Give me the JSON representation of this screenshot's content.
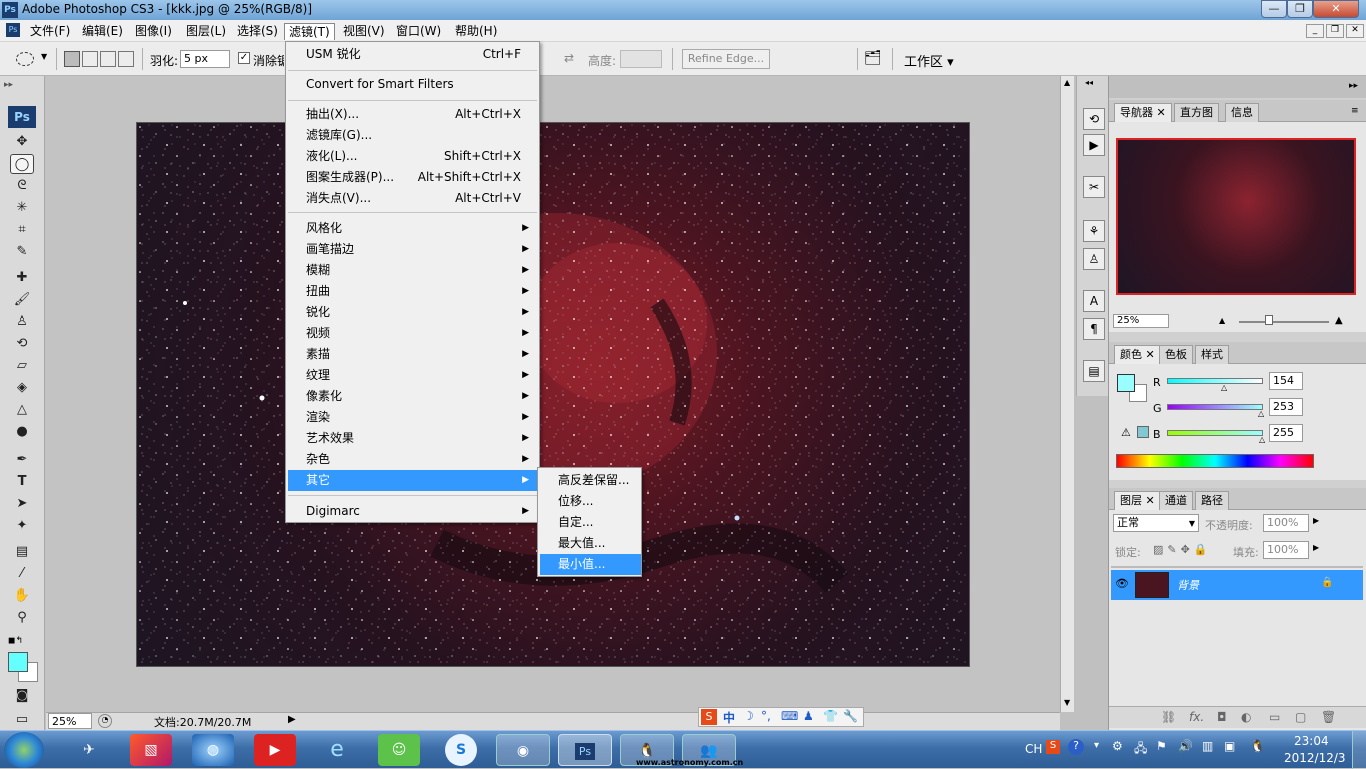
{
  "window": {
    "title": "Adobe Photoshop CS3 - [kkk.jpg @ 25%(RGB/8)]",
    "app_icon": "Ps"
  },
  "menubar": {
    "items": [
      "文件(F)",
      "编辑(E)",
      "图像(I)",
      "图层(L)",
      "选择(S)",
      "滤镜(T)",
      "视图(V)",
      "窗口(W)",
      "帮助(H)"
    ],
    "active": "滤镜(T)"
  },
  "options": {
    "feather_label": "羽化:",
    "feather_value": "5 px",
    "antialias_label": "消除锯齿",
    "height_label": "高度:",
    "refine_edge": "Refine Edge...",
    "workspace": "工作区 ▾"
  },
  "filter_menu": {
    "last": {
      "label": "USM 锐化",
      "shortcut": "Ctrl+F"
    },
    "smart": "Convert for Smart Filters",
    "group1": [
      {
        "label": "抽出(X)...",
        "shortcut": "Alt+Ctrl+X"
      },
      {
        "label": "滤镜库(G)...",
        "shortcut": ""
      },
      {
        "label": "液化(L)...",
        "shortcut": "Shift+Ctrl+X"
      },
      {
        "label": "图案生成器(P)...",
        "shortcut": "Alt+Shift+Ctrl+X"
      },
      {
        "label": "消失点(V)...",
        "shortcut": "Alt+Ctrl+V"
      }
    ],
    "submenus": [
      "风格化",
      "画笔描边",
      "模糊",
      "扭曲",
      "锐化",
      "视频",
      "素描",
      "纹理",
      "像素化",
      "渲染",
      "艺术效果",
      "杂色",
      "其它"
    ],
    "highlighted": "其它",
    "digimarc": "Digimarc"
  },
  "other_submenu": {
    "items": [
      "高反差保留...",
      "位移...",
      "自定...",
      "最大值...",
      "最小值..."
    ],
    "highlighted": "最小值..."
  },
  "status": {
    "zoom": "25%",
    "doc": "文档:20.7M/20.7M"
  },
  "navigator": {
    "tabs": [
      "导航器",
      "直方图",
      "信息"
    ],
    "zoom": "25%"
  },
  "color_panel": {
    "tabs": [
      "颜色",
      "色板",
      "样式"
    ],
    "r_label": "R",
    "g_label": "G",
    "b_label": "B",
    "r": "154",
    "g": "253",
    "b": "255",
    "fg_color": "#9afdff"
  },
  "layers_panel": {
    "tabs": [
      "图层",
      "通道",
      "路径"
    ],
    "blend": "正常",
    "opacity_label": "不透明度:",
    "opacity": "100%",
    "lock_label": "锁定:",
    "fill_label": "填充:",
    "fill": "100%",
    "layer_name": "背景"
  },
  "ime_bar": {
    "text": "中"
  },
  "taskbar": {
    "time": "23:04",
    "date": "2012/12/3",
    "lang": "CH",
    "watermark": "www.astronomy.com.cn"
  },
  "colors": {
    "highlight": "#3399ff",
    "foreground": "#66ffff"
  }
}
